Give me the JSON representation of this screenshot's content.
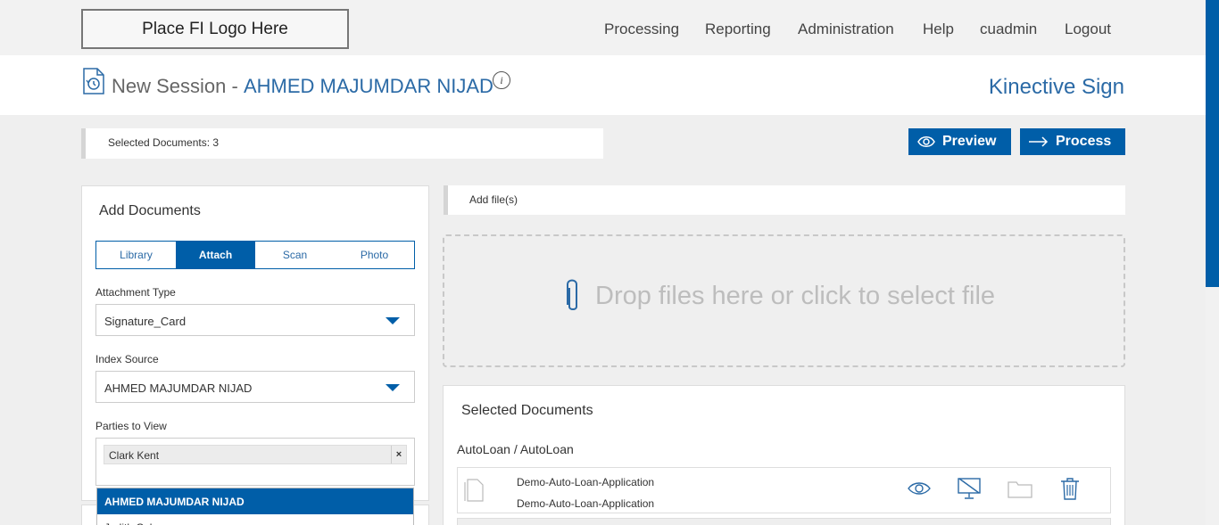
{
  "nav": {
    "logo": "Place FI Logo Here",
    "items": [
      "Processing",
      "Reporting",
      "Administration",
      "Help",
      "cuadmin",
      "Logout"
    ]
  },
  "header": {
    "session_label": "New Session -",
    "customer_name": "AHMED MAJUMDAR NIJAD",
    "info_glyph": "i",
    "brand": "Kinective Sign"
  },
  "toolbar": {
    "selected_text": "Selected Documents: 3",
    "preview_label": "Preview",
    "process_label": "Process"
  },
  "add_documents": {
    "title": "Add Documents",
    "tabs": [
      "Library",
      "Attach",
      "Scan",
      "Photo"
    ],
    "active_tab": "Attach",
    "attachment_type_label": "Attachment Type",
    "attachment_type_value": "Signature_Card",
    "index_source_label": "Index Source",
    "index_source_value": "AHMED MAJUMDAR NIJAD",
    "parties_label": "Parties to View",
    "parties_selected": [
      "Clark Kent"
    ],
    "remove_glyph": "×",
    "dropdown_options": [
      "AHMED MAJUMDAR NIJAD",
      "Judith Cole"
    ]
  },
  "upload": {
    "add_files_label": "Add file(s)",
    "drop_text": "Drop files here or click to select file"
  },
  "selected_documents": {
    "title": "Selected Documents",
    "group": "AutoLoan / AutoLoan",
    "rows": [
      {
        "name": "Demo-Auto-Loan-Application",
        "subname": "Demo-Auto-Loan-Application"
      }
    ]
  },
  "colors": {
    "accent": "#005ea8",
    "brand_text": "#2b6aa6"
  },
  "icons": [
    "history-icon",
    "info-icon",
    "eye-icon",
    "arrow-right-icon",
    "paperclip-icon",
    "document-icon",
    "no-display-icon",
    "folder-icon",
    "trash-icon",
    "chevron-down-icon"
  ]
}
